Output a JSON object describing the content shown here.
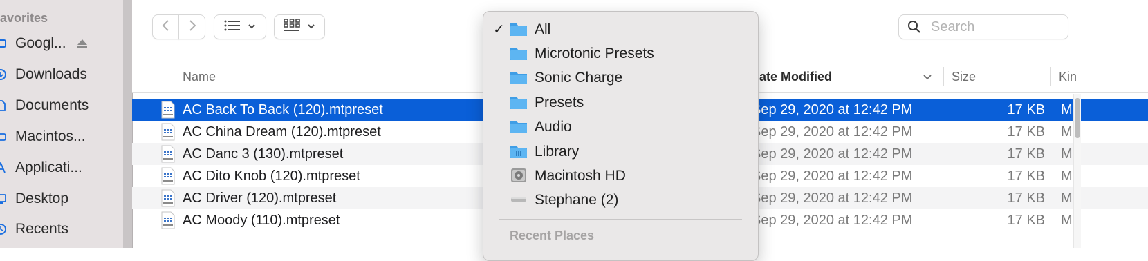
{
  "sidebar": {
    "header": "avorites",
    "items": [
      {
        "label": "Googl...",
        "icon": "drive-icon",
        "eject": true
      },
      {
        "label": "Downloads",
        "icon": "downloads-icon"
      },
      {
        "label": "Documents",
        "icon": "document-icon"
      },
      {
        "label": "Macintos...",
        "icon": "disk-icon"
      },
      {
        "label": "Applicati...",
        "icon": "applications-icon"
      },
      {
        "label": "Desktop",
        "icon": "desktop-icon"
      },
      {
        "label": "Recents",
        "icon": "recents-icon"
      }
    ]
  },
  "toolbar": {
    "back_icon": "chevron-left-icon",
    "forward_icon": "chevron-right-icon",
    "list_view_icon": "list-view-icon",
    "group_icon": "grid-view-icon"
  },
  "search": {
    "placeholder": "Search"
  },
  "columns": {
    "name": "Name",
    "date_modified": "Date Modified",
    "size": "Size",
    "kind": "Kin"
  },
  "files": [
    {
      "name": "AC Back To Back (120).mtpreset",
      "date": "Sep 29, 2020 at 12:42 PM",
      "size": "17 KB",
      "kind": "Mi",
      "selected": true
    },
    {
      "name": "AC China Dream (120).mtpreset",
      "date": "Sep 29, 2020 at 12:42 PM",
      "size": "17 KB",
      "kind": "Mi"
    },
    {
      "name": "AC Danc 3 (130).mtpreset",
      "date": "Sep 29, 2020 at 12:42 PM",
      "size": "17 KB",
      "kind": "Mi"
    },
    {
      "name": "AC Dito Knob (120).mtpreset",
      "date": "Sep 29, 2020 at 12:42 PM",
      "size": "17 KB",
      "kind": "Mi"
    },
    {
      "name": "AC Driver (120).mtpreset",
      "date": "Sep 29, 2020 at 12:42 PM",
      "size": "17 KB",
      "kind": "Mi"
    },
    {
      "name": "AC Moody (110).mtpreset",
      "date": "Sep 29, 2020 at 12:42 PM",
      "size": "17 KB",
      "kind": "Mi"
    }
  ],
  "popup": {
    "items": [
      {
        "label": "All",
        "icon": "folder-icon",
        "checked": true
      },
      {
        "label": "Microtonic Presets",
        "icon": "folder-icon"
      },
      {
        "label": "Sonic Charge",
        "icon": "folder-icon"
      },
      {
        "label": "Presets",
        "icon": "folder-icon"
      },
      {
        "label": "Audio",
        "icon": "folder-icon"
      },
      {
        "label": "Library",
        "icon": "library-folder-icon"
      },
      {
        "label": "Macintosh HD",
        "icon": "hard-drive-icon"
      },
      {
        "label": "Stephane (2)",
        "icon": "external-drive-icon"
      }
    ],
    "section_label": "Recent Places"
  },
  "colors": {
    "selection": "#0a5fd8",
    "folder": "#4aa8ec",
    "sidebar_bg": "#e6e1e2",
    "popup_bg": "#eae8e8"
  }
}
